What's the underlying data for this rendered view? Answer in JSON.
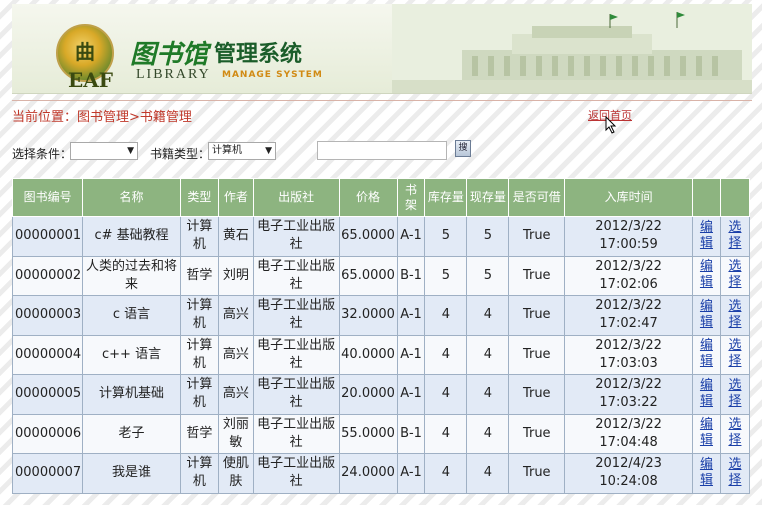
{
  "header": {
    "logo_text": "曲 EAF",
    "title_cn_calligraphy": "图书馆",
    "title_cn": "管理系统",
    "title_en_1": "LIBRARY",
    "title_en_2": "MANAGE SYSTEM"
  },
  "breadcrumb": "当前位置：图书管理>书籍管理",
  "home_link": "返回首页",
  "filters": {
    "condition_label": "选择条件：",
    "condition_value": "",
    "type_label": "书籍类型：",
    "type_value": "计算机",
    "search_button": "搜"
  },
  "table": {
    "headers": [
      "图书编号",
      "名称",
      "类型",
      "作者",
      "出版社",
      "价格",
      "书架",
      "库存量",
      "现存量",
      "是否可借",
      "入库时间",
      "",
      ""
    ],
    "edit_label": "编辑",
    "select_label": "选择",
    "rows": [
      {
        "id": "00000001",
        "name": "c# 基础教程",
        "type": "计算机",
        "author": "黄石",
        "publisher": "电子工业出版社",
        "price": "65.0000",
        "shelf": "A-1",
        "stock": "5",
        "current": "5",
        "borrowable": "True",
        "time": "2012/3/22 17:00:59"
      },
      {
        "id": "00000002",
        "name": "人类的过去和将来",
        "type": "哲学",
        "author": "刘明",
        "publisher": "电子工业出版社",
        "price": "65.0000",
        "shelf": "B-1",
        "stock": "5",
        "current": "5",
        "borrowable": "True",
        "time": "2012/3/22 17:02:06"
      },
      {
        "id": "00000003",
        "name": "c 语言",
        "type": "计算机",
        "author": "高兴",
        "publisher": "电子工业出版社",
        "price": "32.0000",
        "shelf": "A-1",
        "stock": "4",
        "current": "4",
        "borrowable": "True",
        "time": "2012/3/22 17:02:47"
      },
      {
        "id": "00000004",
        "name": "c++ 语言",
        "type": "计算机",
        "author": "高兴",
        "publisher": "电子工业出版社",
        "price": "40.0000",
        "shelf": "A-1",
        "stock": "4",
        "current": "4",
        "borrowable": "True",
        "time": "2012/3/22 17:03:03"
      },
      {
        "id": "00000005",
        "name": "计算机基础",
        "type": "计算机",
        "author": "高兴",
        "publisher": "电子工业出版社",
        "price": "20.0000",
        "shelf": "A-1",
        "stock": "4",
        "current": "4",
        "borrowable": "True",
        "time": "2012/3/22 17:03:22"
      },
      {
        "id": "00000006",
        "name": "老子",
        "type": "哲学",
        "author": "刘丽敏",
        "publisher": "电子工业出版社",
        "price": "55.0000",
        "shelf": "B-1",
        "stock": "4",
        "current": "4",
        "borrowable": "True",
        "time": "2012/3/22 17:04:48"
      },
      {
        "id": "00000007",
        "name": "我是谁",
        "type": "计算机",
        "author": "使肌肤",
        "publisher": "电子工业出版社",
        "price": "24.0000",
        "shelf": "A-1",
        "stock": "4",
        "current": "4",
        "borrowable": "True",
        "time": "2012/4/23 10:24:08"
      }
    ]
  },
  "colors": {
    "header_green": "#8db480",
    "row_odd": "#e2eaf6",
    "row_even": "#f7f9fc",
    "breadcrumb_red": "#c0392b",
    "link_blue": "#1a3fa8"
  }
}
